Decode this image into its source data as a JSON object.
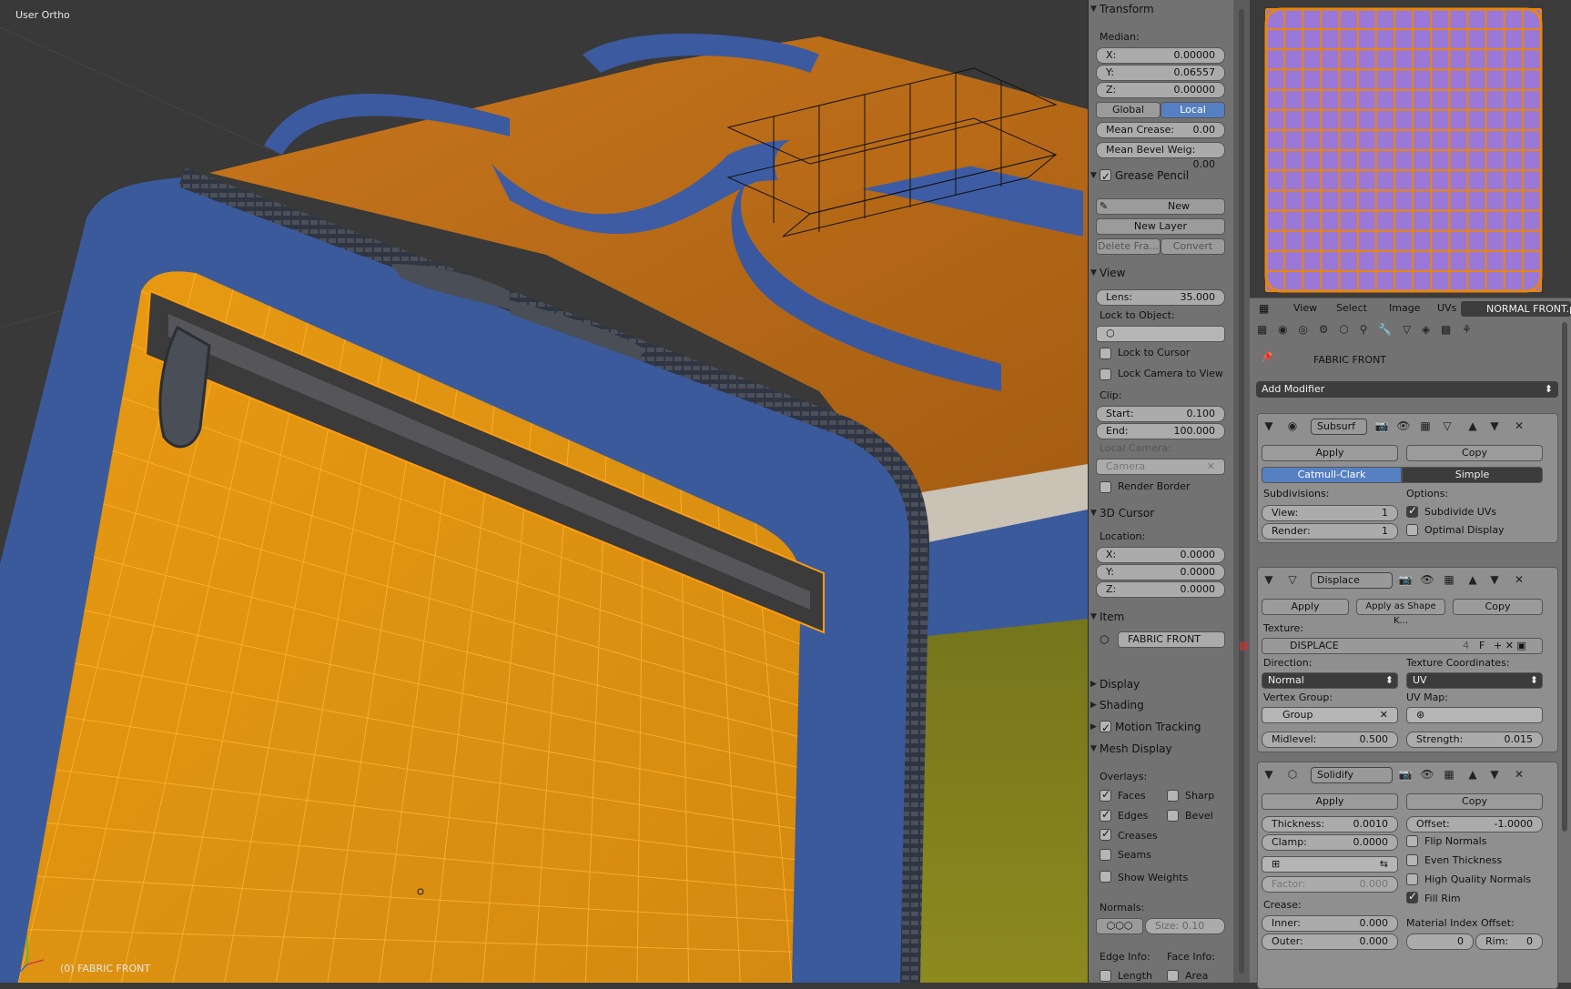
{
  "viewport": {
    "view_label": "User Ortho",
    "object_label": "(0) FABRIC FRONT"
  },
  "transform": {
    "title": "Transform",
    "median_label": "Median:",
    "x": {
      "k": "X:",
      "v": "0.00000"
    },
    "y": {
      "k": "Y:",
      "v": "0.06557"
    },
    "z": {
      "k": "Z:",
      "v": "0.00000"
    },
    "global": "Global",
    "local": "Local",
    "mean_crease": {
      "k": "Mean Crease:",
      "v": "0.00"
    },
    "mean_bevel": {
      "k": "Mean Bevel Weig:",
      "v": "0.00"
    }
  },
  "grease": {
    "title": "Grease Pencil",
    "new": "New",
    "new_layer": "New Layer",
    "delete_frame": "Delete Fra...",
    "convert": "Convert"
  },
  "view": {
    "title": "View",
    "lens": {
      "k": "Lens:",
      "v": "35.000"
    },
    "lock_to_object": "Lock to Object:",
    "lock_cursor": "Lock to Cursor",
    "lock_camera": "Lock Camera to View",
    "clip": "Clip:",
    "start": {
      "k": "Start:",
      "v": "0.100"
    },
    "end": {
      "k": "End:",
      "v": "100.000"
    },
    "local_camera": "Local Camera:",
    "camera": "Camera",
    "render_border": "Render Border"
  },
  "cursor": {
    "title": "3D Cursor",
    "location": "Location:",
    "x": {
      "k": "X:",
      "v": "0.0000"
    },
    "y": {
      "k": "Y:",
      "v": "0.0000"
    },
    "z": {
      "k": "Z:",
      "v": "0.0000"
    }
  },
  "item": {
    "title": "Item",
    "name": "FABRIC FRONT"
  },
  "collapsed": {
    "display": "Display",
    "shading": "Shading",
    "motion": "Motion Tracking"
  },
  "mesh_display": {
    "title": "Mesh Display",
    "overlays": "Overlays:",
    "faces": "Faces",
    "edges": "Edges",
    "creases": "Creases",
    "seams": "Seams",
    "show_weights": "Show Weights",
    "sharp": "Sharp",
    "bevel": "Bevel",
    "normals": "Normals:",
    "size": "Size: 0.10",
    "edge_info": "Edge Info:",
    "face_info": "Face Info:",
    "length": "Length",
    "area": "Area"
  },
  "uv_header": {
    "view": "View",
    "select": "Select",
    "image": "Image",
    "uvs": "UVs",
    "image_name": "NORMAL FRONT.p"
  },
  "props": {
    "object_name": "FABRIC FRONT",
    "add_modifier": "Add Modifier"
  },
  "subsurf": {
    "name": "Subsurf",
    "apply": "Apply",
    "copy": "Copy",
    "catmull": "Catmull-Clark",
    "simple": "Simple",
    "subdivisions": "Subdivisions:",
    "options": "Options:",
    "view": {
      "k": "View:",
      "v": "1"
    },
    "render": {
      "k": "Render:",
      "v": "1"
    },
    "subdivide_uvs": "Subdivide UVs",
    "optimal_display": "Optimal Display"
  },
  "displace": {
    "name": "Displace",
    "apply": "Apply",
    "apply_shape": "Apply as Shape K...",
    "copy": "Copy",
    "texture": "Texture:",
    "tex_name": "DISPLACE",
    "tex_users": "4",
    "fake": "F",
    "direction": "Direction:",
    "direction_val": "Normal",
    "tex_coords": "Texture Coordinates:",
    "tex_coords_val": "UV",
    "vertex_group": "Vertex Group:",
    "group": "Group",
    "uv_map": "UV Map:",
    "midlevel": {
      "k": "Midlevel:",
      "v": "0.500"
    },
    "strength": {
      "k": "Strength:",
      "v": "0.015"
    }
  },
  "solidify": {
    "name": "Solidify",
    "apply": "Apply",
    "copy": "Copy",
    "thickness": {
      "k": "Thickness:",
      "v": "0.0010"
    },
    "offset": {
      "k": "Offset:",
      "v": "-1.0000"
    },
    "clamp": {
      "k": "Clamp:",
      "v": "0.0000"
    },
    "flip_normals": "Flip Normals",
    "even_thickness": "Even Thickness",
    "high_quality": "High Quality Normals",
    "fill_rim": "Fill Rim",
    "factor": {
      "k": "Factor:",
      "v": "0.000"
    },
    "crease": "Crease:",
    "inner": {
      "k": "Inner:",
      "v": "0.000"
    },
    "outer": {
      "k": "Outer:",
      "v": "0.000"
    },
    "material_offset": "Material Index Offset:",
    "mat": {
      "k": "",
      "v": "0"
    },
    "rim": {
      "k": "Rim:",
      "v": "0"
    }
  },
  "colors": {
    "orange": "#e5960f",
    "blue": "#3a5a9c",
    "selected_blue": "#5680c2"
  }
}
